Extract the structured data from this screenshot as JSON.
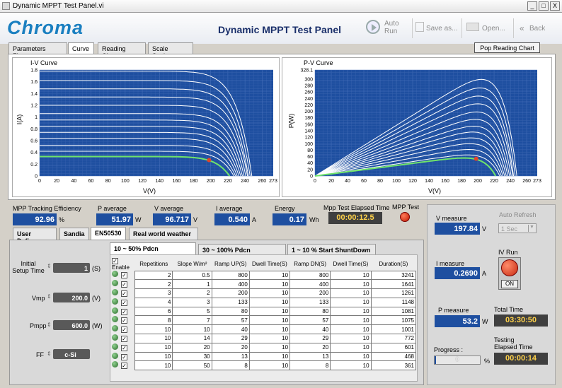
{
  "window": {
    "title": "Dynamic MPPT Test Panel.vi",
    "min": "_",
    "max": "□",
    "close": "X"
  },
  "header": {
    "logo": "Chroma",
    "title": "Dynamic MPPT Test Panel",
    "auto_run": "Auto Run",
    "save_as": "Save as...",
    "open": "Open...",
    "back": "Back"
  },
  "tabs": [
    "Parameters Figure",
    "Curve",
    "Reading Chart",
    "Scale Setting"
  ],
  "pop_button": "Pop Reading Chart",
  "chart_data": [
    {
      "type": "line",
      "title": "I-V Curve",
      "xlabel": "V(V)",
      "ylabel": "I(A)",
      "xlim": [
        0,
        273
      ],
      "ylim": [
        0,
        1.8
      ],
      "xticks": [
        "0",
        "20",
        "40",
        "60",
        "80",
        "100",
        "120",
        "140",
        "160",
        "180",
        "200",
        "220",
        "240",
        "260",
        "273"
      ],
      "yticks": [
        "0",
        "0.2",
        "0.4",
        "0.6",
        "0.8",
        "1",
        "1.2",
        "1.4",
        "1.6",
        "1.8"
      ],
      "isc": [
        1.78,
        1.62,
        1.48,
        1.34,
        1.2,
        1.06,
        0.95,
        0.84,
        0.74,
        0.64,
        0.52,
        0.42,
        0.33
      ],
      "voc": [
        248,
        246,
        244,
        243,
        241,
        239,
        237,
        235,
        233,
        231,
        229,
        227,
        222
      ],
      "highlight_index": 12,
      "mpp": {
        "v": 198,
        "i": 0.27
      },
      "grid": true
    },
    {
      "type": "line",
      "title": "P-V Curve",
      "xlabel": "V(V)",
      "ylabel": "P(W)",
      "xlim": [
        0,
        273
      ],
      "ylim": [
        0,
        328.1
      ],
      "xticks": [
        "0",
        "20",
        "40",
        "60",
        "80",
        "100",
        "120",
        "140",
        "160",
        "180",
        "200",
        "220",
        "240",
        "260",
        "273"
      ],
      "yticks": [
        "0",
        "20",
        "40",
        "60",
        "80",
        "100",
        "120",
        "140",
        "160",
        "180",
        "200",
        "220",
        "240",
        "260",
        "280",
        "300",
        "328.1"
      ],
      "pmax": [
        298,
        272,
        247,
        223,
        198,
        175,
        154,
        136,
        118,
        100,
        82,
        65,
        55
      ],
      "vmp": [
        200,
        199,
        198,
        197,
        196,
        195,
        194,
        193,
        192,
        191,
        190,
        190,
        190
      ],
      "voc": [
        248,
        246,
        244,
        243,
        241,
        239,
        237,
        235,
        233,
        231,
        229,
        227,
        222
      ],
      "highlight_index": 12,
      "mpp": {
        "v": 198,
        "p": 53.2
      },
      "grid": true
    }
  ],
  "readings": {
    "eff_label": "MPP Tracking Efficiency",
    "eff": "92.96",
    "eff_unit": "%",
    "pavg_label": "P average",
    "pavg": "51.97",
    "pavg_unit": "W",
    "vavg_label": "V average",
    "vavg": "96.717",
    "vavg_unit": "V",
    "iavg_label": "I average",
    "iavg": "0.540",
    "iavg_unit": "A",
    "energy_label": "Energy",
    "energy": "0.17",
    "energy_unit": "Wh",
    "elapsed_label": "Mpp Test Elapsed Time",
    "elapsed": "00:00:12.5",
    "mpptest_label": "MPP Test"
  },
  "std_tabs": [
    "User Define",
    "Sandia",
    "EN50530",
    "Real world weather"
  ],
  "sub_tabs": [
    "10 ~ 50% Pdcn",
    "30 ~ 100% Pdcn",
    "1 ~ 10 % Start ShuntDown"
  ],
  "params": {
    "setup_label": "Initial Setup Time",
    "setup": "1",
    "setup_unit": "(S)",
    "vmp_label": "Vmp",
    "vmp": "200.0",
    "vmp_unit": "(V)",
    "pmpp_label": "Pmpp",
    "pmpp": "600.0",
    "pmpp_unit": "(W)",
    "ff_label": "FF",
    "ff": "c-Si"
  },
  "table": {
    "headers": [
      "Enable",
      "Repetitions",
      "Slope W/m²",
      "Ramp UP(S)",
      "Dwell Time(S)",
      "Ramp DN(S)",
      "Dwell Time(S)",
      "Duration(S)"
    ],
    "rows": [
      [
        "2",
        "0.5",
        "800",
        "10",
        "800",
        "10",
        "3241"
      ],
      [
        "2",
        "1",
        "400",
        "10",
        "400",
        "10",
        "1641"
      ],
      [
        "3",
        "2",
        "200",
        "10",
        "200",
        "10",
        "1261"
      ],
      [
        "4",
        "3",
        "133",
        "10",
        "133",
        "10",
        "1148"
      ],
      [
        "6",
        "5",
        "80",
        "10",
        "80",
        "10",
        "1081"
      ],
      [
        "8",
        "7",
        "57",
        "10",
        "57",
        "10",
        "1075"
      ],
      [
        "10",
        "10",
        "40",
        "10",
        "40",
        "10",
        "1001"
      ],
      [
        "10",
        "14",
        "29",
        "10",
        "29",
        "10",
        "772"
      ],
      [
        "10",
        "20",
        "20",
        "10",
        "20",
        "10",
        "601"
      ],
      [
        "10",
        "30",
        "13",
        "10",
        "13",
        "10",
        "468"
      ],
      [
        "10",
        "50",
        "8",
        "10",
        "8",
        "10",
        "361"
      ]
    ]
  },
  "right": {
    "vmeas_label": "V measure",
    "vmeas": "197.84",
    "vmeas_unit": "V",
    "auto_refresh_label": "Auto Refresh",
    "auto_refresh": "1 Sec",
    "imeas_label": "I measure",
    "imeas": "0.2690",
    "imeas_unit": "A",
    "ivrun_label": "IV Run",
    "ivrun_state": "ON",
    "pmeas_label": "P measure",
    "pmeas": "53.2",
    "pmeas_unit": "W",
    "total_label": "Total Time",
    "total": "03:30:50",
    "progress_label": "Progress :",
    "progress": "0",
    "progress_unit": "%",
    "testing_label": "Testing Elapsed Time",
    "testing": "00:00:14"
  }
}
